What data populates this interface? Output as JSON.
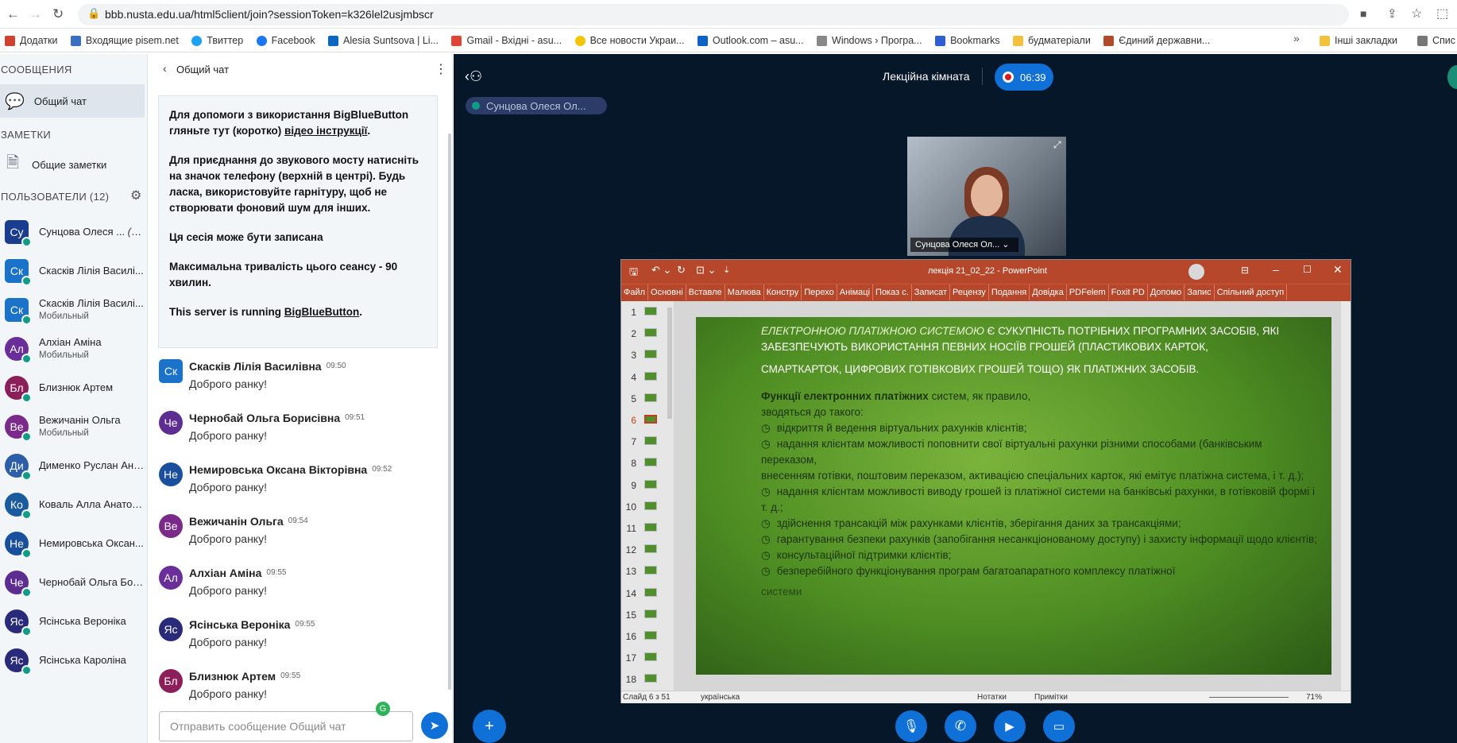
{
  "browser": {
    "url": "bbb.nusta.edu.ua/html5client/join?sessionToken=k326lel2usjmbscr",
    "bookmarks": [
      "Додатки",
      "Входящие pisem.net",
      "Твиттер",
      "Facebook",
      "Alesia Suntsova | Li...",
      "Gmail - Вхідні - asu...",
      "Все новости Украи...",
      "Outlook.com – asu...",
      "Windows › Програ...",
      "Bookmarks",
      "будматеріали",
      "Єдиний державни...",
      "Інші закладки",
      "Спис"
    ]
  },
  "sidebar": {
    "messages_header": "СООБЩЕНИЯ",
    "public_chat": "Общий чат",
    "notes_header": "ЗАМЕТКИ",
    "shared_notes": "Общие заметки",
    "users_header": "ПОЛЬЗОВАТЕЛИ (12)",
    "users": [
      {
        "initials": "Су",
        "name": "Сунцова Олеся ...",
        "suffix": "(Вы)",
        "sub": "",
        "color": "#1a3d8f",
        "shape": "square"
      },
      {
        "initials": "Ск",
        "name": "Скасків Лілія Василі...",
        "suffix": "",
        "sub": "",
        "color": "#1a73c9",
        "shape": "square"
      },
      {
        "initials": "Ск",
        "name": "Скасків Лілія Василі...",
        "suffix": "",
        "sub": "Мобильный",
        "color": "#1a73c9",
        "shape": "square"
      },
      {
        "initials": "Ал",
        "name": "Алхіан Аміна",
        "suffix": "",
        "sub": "Мобильный",
        "color": "#6a2e9a",
        "shape": "round"
      },
      {
        "initials": "Бл",
        "name": "Близнюк Артем",
        "suffix": "",
        "sub": "",
        "color": "#8c1e5a",
        "shape": "round"
      },
      {
        "initials": "Ве",
        "name": "Вежичанін Ольга",
        "suffix": "",
        "sub": "Мобильный",
        "color": "#7b2a8a",
        "shape": "round"
      },
      {
        "initials": "Ди",
        "name": "Дименко Руслан Ана...",
        "suffix": "",
        "sub": "",
        "color": "#2c5fa8",
        "shape": "round"
      },
      {
        "initials": "Ко",
        "name": "Коваль Алла Анатол...",
        "suffix": "",
        "sub": "",
        "color": "#1a5a9e",
        "shape": "round"
      },
      {
        "initials": "Не",
        "name": "Немировська Оксан...",
        "suffix": "",
        "sub": "",
        "color": "#1a4f9e",
        "shape": "round"
      },
      {
        "initials": "Че",
        "name": "Чернобай Ольга Бор...",
        "suffix": "",
        "sub": "",
        "color": "#5e2d91",
        "shape": "round"
      },
      {
        "initials": "Яс",
        "name": "Ясінська Вероніка",
        "suffix": "",
        "sub": "",
        "color": "#2a2a7a",
        "shape": "round"
      },
      {
        "initials": "Яс",
        "name": "Ясінська Кароліна",
        "suffix": "",
        "sub": "",
        "color": "#2a2a7a",
        "shape": "round"
      }
    ]
  },
  "chat": {
    "title": "Общий чат",
    "welcome": {
      "p1a": "Для допомоги з використання BigBlueButton гляньте тут (коротко) ",
      "p1link": "відео інструкції",
      "p2": "Для приєднання до звукового мосту натисніть на значок телефону (верхній в центрі). Будь ласка, використовуйте гарнітуру, щоб не створювати фоновий шум для інших.",
      "p3": "Ця сесія може бути записана",
      "p4": "Максимальна тривалість цього сеансу - 90 хвилин.",
      "p5a": "This server is running ",
      "p5link": "BigBlueButton"
    },
    "messages": [
      {
        "initials": "Ск",
        "color": "#1a73c9",
        "shape": "square",
        "name": "Скасків Лілія Василівна",
        "time": "09:50",
        "text": "Доброго ранку!"
      },
      {
        "initials": "Че",
        "color": "#5e2d91",
        "shape": "round",
        "name": "Чернобай Ольга Борисівна",
        "time": "09:51",
        "text": "Доброго ранку!"
      },
      {
        "initials": "Не",
        "color": "#1a4f9e",
        "shape": "round",
        "name": "Немировська Оксана Вікторівна",
        "time": "09:52",
        "text": "Доброго ранку!"
      },
      {
        "initials": "Ве",
        "color": "#7b2a8a",
        "shape": "round",
        "name": "Вежичанін Ольга",
        "time": "09:54",
        "text": "Доброго ранку!"
      },
      {
        "initials": "Ал",
        "color": "#6a2e9a",
        "shape": "round",
        "name": "Алхіан Аміна",
        "time": "09:55",
        "text": "Доброго ранку!"
      },
      {
        "initials": "Яс",
        "color": "#2a2a7a",
        "shape": "round",
        "name": "Ясінська Вероніка",
        "time": "09:55",
        "text": "Доброго ранку!"
      },
      {
        "initials": "Бл",
        "color": "#8c1e5a",
        "shape": "round",
        "name": "Близнюк Артем",
        "time": "09:55",
        "text": "Доброго ранку!"
      }
    ],
    "input_placeholder": "Отправить сообщение Общий чат"
  },
  "meeting": {
    "room_title": "Лекційна кімната",
    "record_time": "06:39",
    "presenter_tag": "Сунцова Олеся Ол...",
    "webcam_name": "Сунцова Олеся Ол..."
  },
  "powerpoint": {
    "file_title": "лекція 21_02_22 - PowerPoint",
    "ribbon_tabs": [
      "Файл",
      "Основні",
      "Вставле",
      "Малюва",
      "Констру",
      "Перехо",
      "Анімаці",
      "Показ с.",
      "Записат",
      "Рецензу",
      "Подання",
      "Довідка",
      "PDFelem",
      "Foxit PD",
      "Допомо",
      "Запис",
      "Спільний доступ"
    ],
    "slide_numbers": [
      "1",
      "2",
      "3",
      "4",
      "5",
      "6",
      "7",
      "8",
      "9",
      "10",
      "11",
      "12",
      "13",
      "14",
      "15",
      "16",
      "17",
      "18"
    ],
    "current_slide_index": 5,
    "slide": {
      "intro_highlight": "ЕЛЕКТРОННОЮ ПЛАТІЖНОЮ СИСТЕМОЮ",
      "intro_rest": " Є СУКУПНІСТЬ ПОТРІБНИХ ПРОГРАМНИХ ЗАСОБІВ, ЯКІ ЗАБЕЗПЕЧУЮТЬ ВИКОРИСТАННЯ ПЕВНИХ НОСІЇВ ГРОШЕЙ (ПЛАСТИКОВИХ КАРТОК,",
      "intro_line3": "СМАРТКАРТОК, ЦИФРОВИХ ГОТІВКОВИХ ГРОШЕЙ ТОЩО) ЯК ПЛАТІЖНИХ ЗАСОБІВ.",
      "func_bold": "Функції електронних платіжних",
      "func_rest": " систем, як правило,",
      "func_line2": "зводяться до такого:",
      "bullets": [
        "відкриття й ведення віртуальних рахунків клієнтів;",
        "надання клієнтам можливості поповнити свої віртуальні рахунки різними способами (банківським переказом,",
        "внесенням готівки, поштовим переказом, активацією спеціальних карток, які емітує платіжна система, і т. д.);",
        "надання клієнтам можливості виводу грошей із платіжної системи на банківські рахунки, в готівковій формі і т. д.;",
        "здійснення трансакцій між рахунками клієнтів, зберігання даних за трансакціями;",
        "гарантування безпеки рахунків (запобігання несанкціонованому доступу) і захисту інформації щодо клієнтів;",
        "консультаційної підтримки клієнтів;",
        "безперебійного функціонування програм багатоапаратного комплексу платіжної"
      ],
      "last_line": "системи"
    },
    "status": {
      "slide_pos": "Слайд 6 з 51",
      "language": "українська",
      "notes": "Нотатки",
      "comments": "Примітки",
      "zoom": "71%"
    }
  },
  "colors": {
    "accent": "#0f70d7",
    "main_bg": "#06172a",
    "ppt_red": "#b7472a",
    "recording": "#e0171b"
  }
}
